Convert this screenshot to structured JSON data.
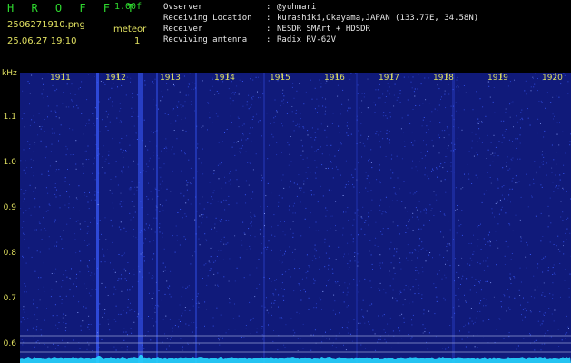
{
  "header": {
    "app_title": "H R O F F T",
    "app_version": "1.00f",
    "file_name": "2506271910.png",
    "meteor_label": "meteor",
    "file_time": "25.06.27 19:10",
    "meteor_count": "1"
  },
  "station": [
    {
      "key": "Ovserver",
      "sep": ":",
      "value": "@yuhmari"
    },
    {
      "key": "Receiving Location",
      "sep": ":",
      "value": "kurashiki,Okayama,JAPAN (133.77E, 34.58N)"
    },
    {
      "key": "Receiver",
      "sep": ":",
      "value": "NESDR SMArt + HDSDR"
    },
    {
      "key": "Recviving antenna",
      "sep": ":",
      "value": "Radix RV-62V"
    }
  ],
  "spectrogram": {
    "y_unit": "kHz",
    "y_ticks": [
      "1.1",
      "1.0",
      "0.9",
      "0.8",
      "0.7",
      "0.6"
    ],
    "x_ticks": [
      "1911",
      "1912",
      "1913",
      "1914",
      "1915",
      "1916",
      "1917",
      "1918",
      "1919",
      "1920"
    ],
    "background_color": "#101a7a",
    "noise_color": "#3a5cff",
    "baseline_color": "#27d7ff"
  }
}
